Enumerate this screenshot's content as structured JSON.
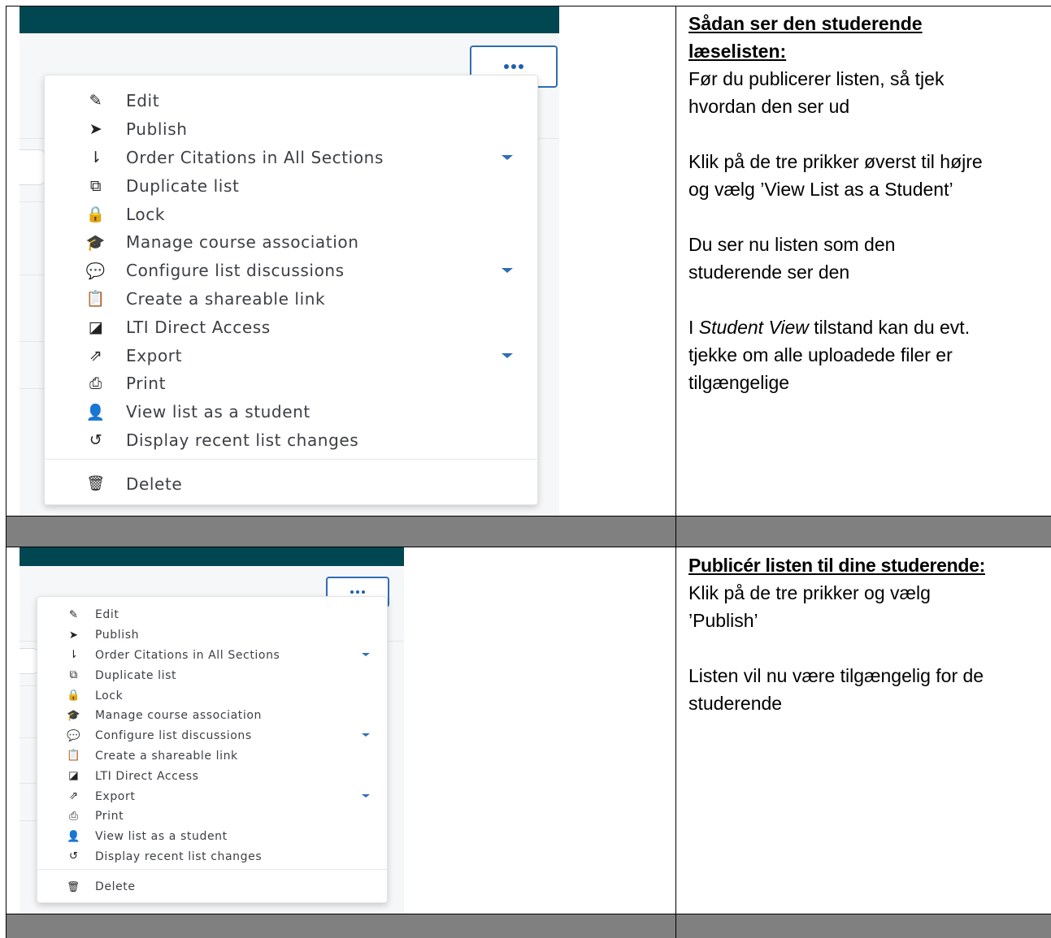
{
  "menu": {
    "more_button_label": "More actions",
    "items": [
      {
        "icon": "pencil-icon",
        "glyph": "✎",
        "label": "Edit",
        "has_caret": false
      },
      {
        "icon": "paper-plane-icon",
        "glyph": "➤",
        "label": "Publish",
        "has_caret": false
      },
      {
        "icon": "sort-icon",
        "glyph": "⇂",
        "label": "Order Citations in All Sections",
        "has_caret": true
      },
      {
        "icon": "duplicate-icon",
        "glyph": "⧉",
        "label": "Duplicate list",
        "has_caret": false
      },
      {
        "icon": "lock-icon",
        "glyph": "🔒",
        "label": "Lock",
        "has_caret": false
      },
      {
        "icon": "graduation-cap-icon",
        "glyph": "🎓",
        "label": "Manage course association",
        "has_caret": false
      },
      {
        "icon": "comments-icon",
        "glyph": "💬",
        "label": "Configure list discussions",
        "has_caret": true
      },
      {
        "icon": "share-file-icon",
        "glyph": "📋",
        "label": "Create a shareable link",
        "has_caret": false
      },
      {
        "icon": "external-square-icon",
        "glyph": "◪",
        "label": "LTI Direct Access",
        "has_caret": false
      },
      {
        "icon": "export-icon",
        "glyph": "⇗",
        "label": "Export",
        "has_caret": true
      },
      {
        "icon": "printer-icon",
        "glyph": "⎙",
        "label": "Print",
        "has_caret": false
      },
      {
        "icon": "user-icon",
        "glyph": "👤",
        "label": "View list as a student",
        "has_caret": false
      },
      {
        "icon": "history-icon",
        "glyph": "↺",
        "label": "Display recent list changes",
        "has_caret": false
      }
    ],
    "delete": {
      "icon": "trash-icon",
      "glyph": "🗑",
      "label": "Delete"
    }
  },
  "section1": {
    "heading_line1": "Sådan ser den studerende",
    "heading_line2": "læselisten:",
    "p1_line1": "Før du publicerer listen, så tjek",
    "p1_line2": "hvordan den ser ud",
    "p2_line1": "Klik på de tre prikker øverst til højre",
    "p2_line2": "og vælg ’View List as a Student’",
    "p3_line1": "Du ser nu listen som den",
    "p3_line2": "studerende ser den",
    "p4_prefix": "I ",
    "p4_italic": "Student View",
    "p4_suffix": " tilstand kan du evt.",
    "p4_line2": "tjekke om alle uploadede filer er",
    "p4_line3": "tilgængelige"
  },
  "section2": {
    "heading": "Publicér listen til dine studerende:",
    "p1_line1": "Klik på de tre prikker og vælg",
    "p1_line2": "’Publish’",
    "p2_line1": "Listen vil nu være tilgængelig for de",
    "p2_line2": "studerende"
  },
  "colors": {
    "teal_header": "#004751",
    "accent_blue": "#2f6db5",
    "row_gray": "#808080"
  }
}
